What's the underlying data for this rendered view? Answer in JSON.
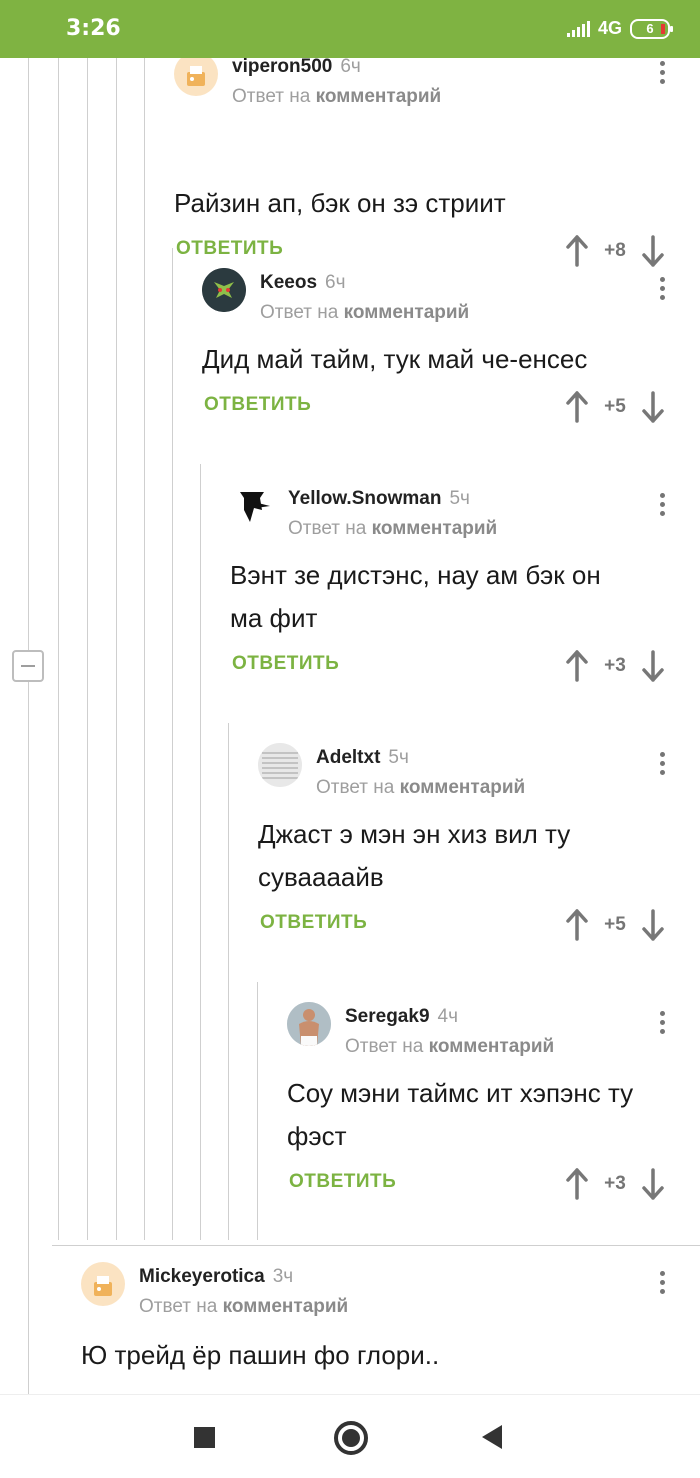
{
  "status_bar": {
    "time": "3:26",
    "network": "4G",
    "battery": "6"
  },
  "reply_prefix": "Ответ на",
  "reply_target": "комментарий",
  "reply_button_label": "ОТВЕТИТЬ",
  "comments": [
    {
      "author": "viperon500",
      "time": "6ч",
      "text": "Райзин ап, бэк он зэ стриит",
      "score": "+8"
    },
    {
      "author": "Keeos",
      "time": "6ч",
      "text": "Дид май тайм, тук май че-енсес",
      "score": "+5"
    },
    {
      "author": "Yellow.Snowman",
      "time": "5ч",
      "text_lines": [
        "Вэнт зе дистэнс, нау ам бэк он",
        "ма фит"
      ],
      "score": "+3"
    },
    {
      "author": "Adeltxt",
      "time": "5ч",
      "text_lines": [
        "Джаст э мэн эн хиз вил ту",
        "суваааайв"
      ],
      "score": "+5"
    },
    {
      "author": "Seregak9",
      "time": "4ч",
      "text_lines": [
        "Соу мэни таймс ит хэпэнс ту",
        "фэст"
      ],
      "score": "+3"
    },
    {
      "author": "Mickeyerotica",
      "time": "3ч",
      "text": "Ю трейд ёр пашин фо глори.."
    }
  ],
  "icons": {
    "upvote": "arrow-up-icon",
    "downvote": "arrow-down-icon",
    "menu": "kebab-menu-icon",
    "collapse": "collapse-thread-icon",
    "nav": [
      "recents-square-icon",
      "home-circle-icon",
      "back-triangle-icon"
    ]
  },
  "colors": {
    "accent": "#7fb342",
    "reply_button": "#7cb342",
    "muted": "#9e9e9e",
    "thread_line": "#cfcfcf"
  }
}
